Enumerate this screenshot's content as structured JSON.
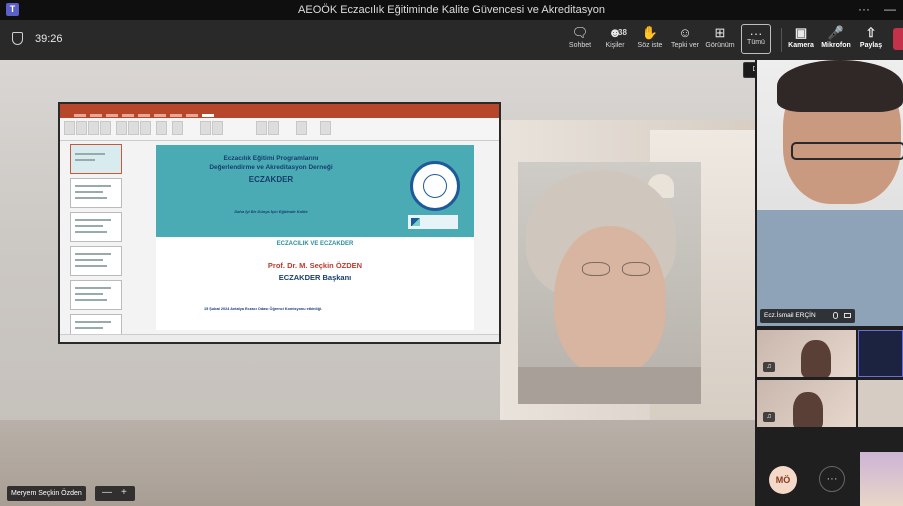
{
  "window": {
    "title": "AEOÖK Eczacılık Eğitiminde Kalite Güvencesi ve Akreditasyon",
    "menu_glyph": "···",
    "minimize_glyph": "—"
  },
  "meeting": {
    "timer": "39:26"
  },
  "toolbar": {
    "chat_label": "Sohbet",
    "people_label": "Kişiler",
    "people_count": "38",
    "raise_label": "Söz iste",
    "react_label": "Tepki ver",
    "view_label": "Görünüm",
    "more_label": "Tümü",
    "camera_label": "Kamera",
    "mic_label": "Mikrofon",
    "share_label": "Paylaş",
    "more_tooltip": "Diğer eylemler"
  },
  "icons": {
    "chat": "chat-icon",
    "people": "people-icon",
    "raise": "hand-icon",
    "react": "smile-icon",
    "view": "grid-icon",
    "more": "more-icon",
    "camera": "camera-icon",
    "mic": "mic-icon",
    "share": "share-icon",
    "shield": "shield-icon"
  },
  "slide": {
    "line1": "Eczacılık Eğitimi Programlarını",
    "line2": "Değerlendirme ve Akreditasyon Derneği",
    "org": "ECZAKDER",
    "slogan": "Daha İyi Bir Dünya İçin Eğitimde Kalite",
    "subtitle": "ECZACILIK VE ECZAKDER",
    "presenter": "Prof. Dr. M. Seçkin ÖZDEN",
    "role": "ECZAKDER Başkanı",
    "footer": "15 Şubat 2024 Antalya Eczacı Odası Öğrenci Komisyonu etkinliği."
  },
  "participants": {
    "pinned_name": "Meryem Seçkin Özden",
    "right_name": "Ecz.İsmail ERÇİN",
    "avatar_initials": "MÖ",
    "overflow_glyph": "···"
  },
  "stage_zoom": {
    "minus": "—",
    "plus": "+"
  },
  "colors": {
    "accent": "#5b5fc7",
    "leave": "#c4314b",
    "slide_teal": "#4aabb5",
    "slide_navy": "#173e6e",
    "slide_red": "#c0392b"
  }
}
